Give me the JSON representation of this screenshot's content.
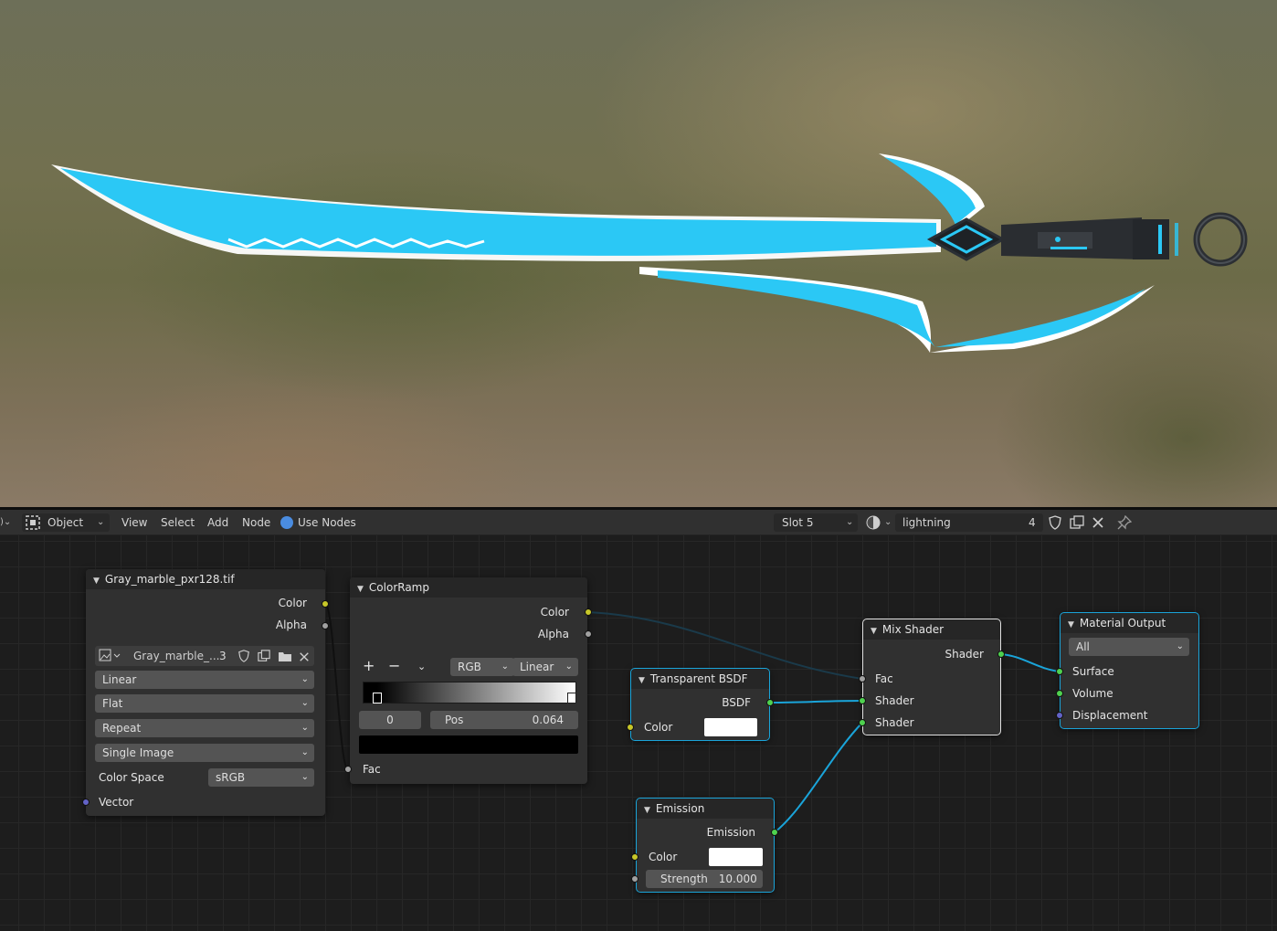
{
  "header": {
    "mode_label": "Object",
    "menu": [
      "View",
      "Select",
      "Add",
      "Node"
    ],
    "use_nodes_label": "Use Nodes",
    "slot_label": "Slot 5",
    "material_name": "lightning",
    "material_users": "4"
  },
  "nodes": {
    "image_texture": {
      "title": "Gray_marble_pxr128.tif",
      "out_color": "Color",
      "out_alpha": "Alpha",
      "image_name": "Gray_marble_...",
      "image_users": "3",
      "interpolation": "Linear",
      "projection": "Flat",
      "extension": "Repeat",
      "source": "Single Image",
      "color_space_label": "Color Space",
      "color_space": "sRGB",
      "in_vector": "Vector"
    },
    "color_ramp": {
      "title": "ColorRamp",
      "out_color": "Color",
      "out_alpha": "Alpha",
      "plus": "+",
      "minus": "−",
      "color_mode": "RGB",
      "interpolation": "Linear",
      "stop_index": "0",
      "pos_label": "Pos",
      "pos_value": "0.064",
      "in_fac": "Fac"
    },
    "transparent_bsdf": {
      "title": "Transparent BSDF",
      "out_bsdf": "BSDF",
      "in_color": "Color",
      "color_swatch": "#ffffff"
    },
    "mix_shader": {
      "title": "Mix Shader",
      "out_shader": "Shader",
      "in_fac": "Fac",
      "in_shader1": "Shader",
      "in_shader2": "Shader"
    },
    "emission": {
      "title": "Emission",
      "out_emission": "Emission",
      "in_color": "Color",
      "color_swatch": "#ffffff",
      "strength_label": "Strength",
      "strength_value": "10.000"
    },
    "material_output": {
      "title": "Material Output",
      "target": "All",
      "in_surface": "Surface",
      "in_volume": "Volume",
      "in_displacement": "Displacement"
    }
  },
  "colors": {
    "socket_color": "#c7c729",
    "socket_float": "#a1a1a1",
    "socket_shader": "#4fd14f",
    "socket_vector": "#6363c7",
    "link_selected": "#1aa4d9",
    "blade_glow": "#2bc8f5"
  },
  "icons": {
    "editor_type": "node-editor-icon",
    "mode": "object-mode-icon",
    "material": "material-sphere-icon",
    "fake_user": "shield-icon",
    "duplicate": "duplicate-icon",
    "unlink": "close-icon",
    "pin": "pin-icon",
    "image": "image-icon",
    "open": "folder-icon"
  }
}
